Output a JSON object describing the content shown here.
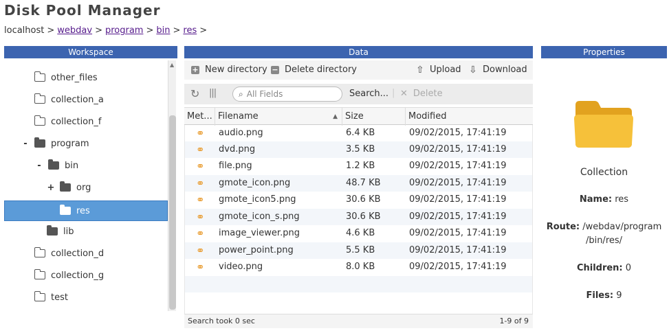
{
  "app": {
    "title": "Disk Pool Manager"
  },
  "breadcrumb": {
    "root": "localhost",
    "links": [
      "webdav",
      "program",
      "bin",
      "res"
    ],
    "separator": ">"
  },
  "panels": {
    "workspace": "Workspace",
    "data": "Data",
    "properties": "Properties"
  },
  "tree": {
    "items": [
      {
        "label": "other_files",
        "expander": "",
        "icon": "folder-outline-icon"
      },
      {
        "label": "collection_a",
        "expander": "",
        "icon": "folder-outline-icon"
      },
      {
        "label": "collection_f",
        "expander": "",
        "icon": "folder-outline-icon"
      },
      {
        "label": "program",
        "expander": "-",
        "icon": "folder-solid-icon"
      },
      {
        "label": "bin",
        "expander": "-",
        "icon": "folder-solid-icon"
      },
      {
        "label": "org",
        "expander": "+",
        "icon": "folder-solid-icon"
      },
      {
        "label": "res",
        "expander": "",
        "icon": "folder-solid-icon",
        "selected": true
      },
      {
        "label": "lib",
        "expander": "",
        "icon": "folder-solid-icon"
      },
      {
        "label": "collection_d",
        "expander": "",
        "icon": "folder-outline-icon"
      },
      {
        "label": "collection_g",
        "expander": "",
        "icon": "folder-outline-icon"
      },
      {
        "label": "test",
        "expander": "",
        "icon": "folder-outline-icon"
      }
    ]
  },
  "toolbar": {
    "new_directory": "New directory",
    "delete_directory": "Delete directory",
    "upload": "Upload",
    "download": "Download",
    "search_placeholder": "All Fields",
    "search_button": "Search...",
    "delete": "Delete"
  },
  "grid": {
    "columns": [
      "Met...",
      "Filename",
      "Size",
      "Modified"
    ],
    "rows": [
      {
        "filename": "audio.png",
        "size": "6.4 KB",
        "modified": "09/02/2015, 17:41:19"
      },
      {
        "filename": "dvd.png",
        "size": "3.5 KB",
        "modified": "09/02/2015, 17:41:19"
      },
      {
        "filename": "file.png",
        "size": "1.2 KB",
        "modified": "09/02/2015, 17:41:19"
      },
      {
        "filename": "gmote_icon.png",
        "size": "48.7 KB",
        "modified": "09/02/2015, 17:41:19"
      },
      {
        "filename": "gmote_icon5.png",
        "size": "30.6 KB",
        "modified": "09/02/2015, 17:41:19"
      },
      {
        "filename": "gmote_icon_s.png",
        "size": "30.6 KB",
        "modified": "09/02/2015, 17:41:19"
      },
      {
        "filename": "image_viewer.png",
        "size": "4.6 KB",
        "modified": "09/02/2015, 17:41:19"
      },
      {
        "filename": "power_point.png",
        "size": "5.5 KB",
        "modified": "09/02/2015, 17:41:19"
      },
      {
        "filename": "video.png",
        "size": "8.0 KB",
        "modified": "09/02/2015, 17:41:19"
      }
    ]
  },
  "status": {
    "left": "Search took 0 sec",
    "right": "1-9 of 9"
  },
  "properties": {
    "type": "Collection",
    "name_label": "Name:",
    "name_value": "res",
    "route_label": "Route:",
    "route_value_1": "/webdav/program",
    "route_value_2": "/bin/res/",
    "children_label": "Children:",
    "children_value": "0",
    "files_label": "Files:",
    "files_value": "9"
  },
  "colors": {
    "header_blue": "#3c64b0",
    "selection_blue": "#5b9bd8",
    "folder_yellow": "#f0b429"
  }
}
